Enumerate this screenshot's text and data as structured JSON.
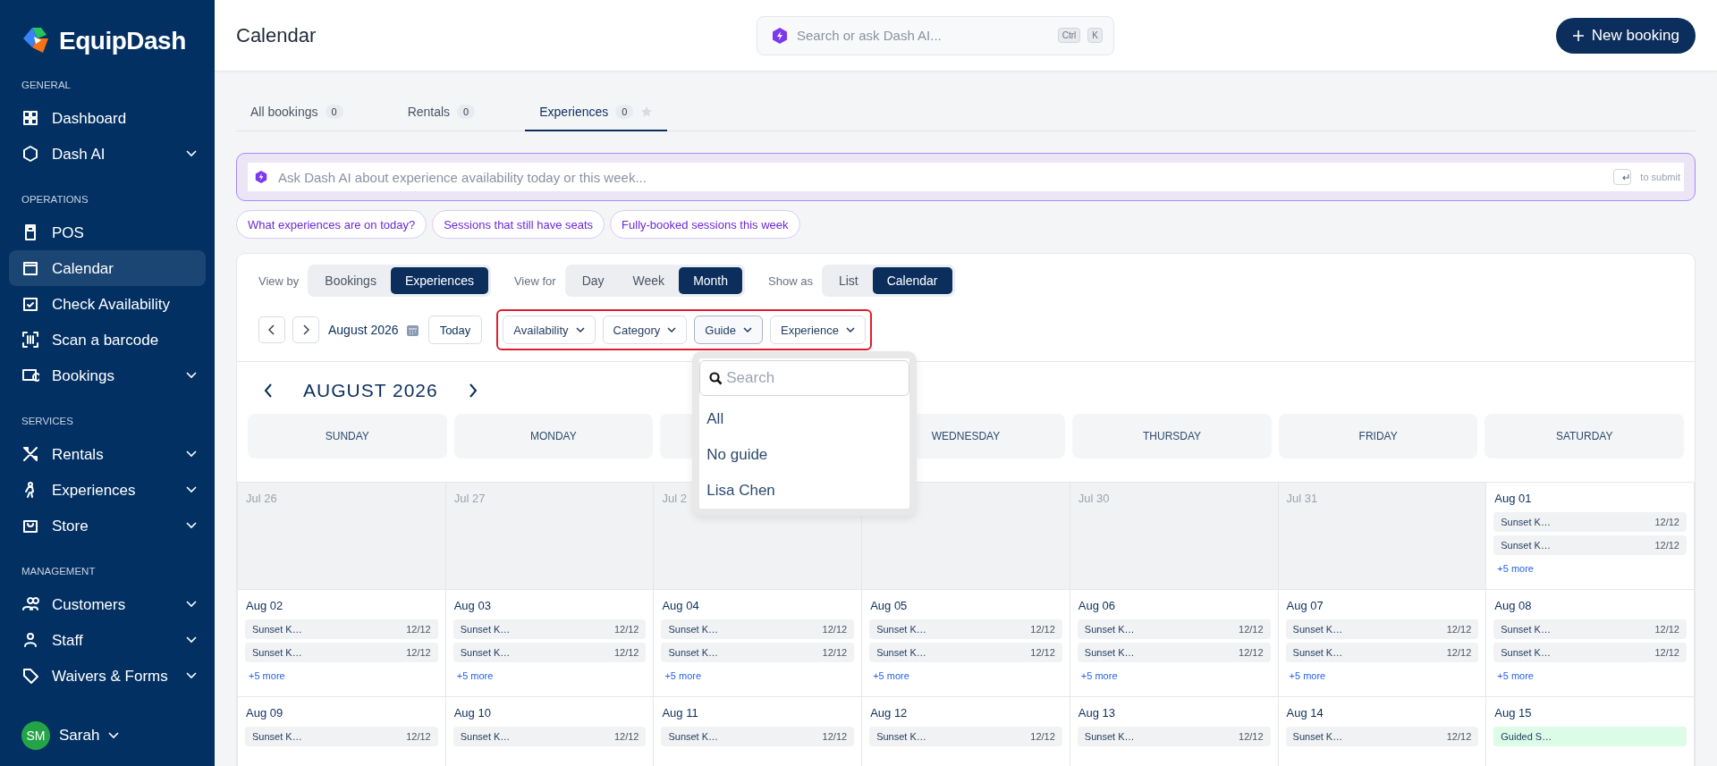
{
  "brand": {
    "name": "EquipDash"
  },
  "sidebar": {
    "sections": [
      {
        "label": "GENERAL",
        "items": [
          {
            "label": "Dashboard",
            "selected": false,
            "expandable": false
          },
          {
            "label": "Dash AI",
            "selected": false,
            "expandable": true
          }
        ]
      },
      {
        "label": "OPERATIONS",
        "items": [
          {
            "label": "POS",
            "selected": false,
            "expandable": false
          },
          {
            "label": "Calendar",
            "selected": true,
            "expandable": false
          },
          {
            "label": "Check Availability",
            "selected": false,
            "expandable": false
          },
          {
            "label": "Scan a barcode",
            "selected": false,
            "expandable": false
          },
          {
            "label": "Bookings",
            "selected": false,
            "expandable": true
          }
        ]
      },
      {
        "label": "SERVICES",
        "items": [
          {
            "label": "Rentals",
            "selected": false,
            "expandable": true
          },
          {
            "label": "Experiences",
            "selected": false,
            "expandable": true
          },
          {
            "label": "Store",
            "selected": false,
            "expandable": true
          }
        ]
      },
      {
        "label": "MANAGEMENT",
        "items": [
          {
            "label": "Customers",
            "selected": false,
            "expandable": true
          },
          {
            "label": "Staff",
            "selected": false,
            "expandable": true
          },
          {
            "label": "Waivers & Forms",
            "selected": false,
            "expandable": true
          }
        ]
      }
    ],
    "user": {
      "initials": "SM",
      "name": "Sarah"
    }
  },
  "header": {
    "title": "Calendar",
    "search": {
      "placeholder": "Search or ask Dash AI...",
      "keys": [
        "Ctrl",
        "K"
      ]
    },
    "new_button": "New booking"
  },
  "tabs": [
    {
      "label": "All bookings",
      "count": "0",
      "selected": false
    },
    {
      "label": "Rentals",
      "count": "0",
      "selected": false
    },
    {
      "label": "Experiences",
      "count": "0",
      "selected": true
    }
  ],
  "ai_prompt": {
    "placeholder": "Ask Dash AI about experience availability today or this week...",
    "hint": "to submit"
  },
  "suggestions": [
    "What experiences are on today?",
    "Sessions that still have seats",
    "Fully-booked sessions this week"
  ],
  "view_controls": [
    {
      "label": "View by",
      "options": [
        {
          "label": "Bookings",
          "selected": false
        },
        {
          "label": "Experiences",
          "selected": true
        }
      ]
    },
    {
      "label": "View for",
      "options": [
        {
          "label": "Day",
          "selected": false
        },
        {
          "label": "Week",
          "selected": false
        },
        {
          "label": "Month",
          "selected": true
        }
      ]
    },
    {
      "label": "Show as",
      "options": [
        {
          "label": "List",
          "selected": false
        },
        {
          "label": "Calendar",
          "selected": true
        }
      ]
    }
  ],
  "period_nav": {
    "period": "August 2026",
    "today": "Today"
  },
  "filters": {
    "highlighted": true,
    "items": [
      {
        "label": "Availability",
        "open": false
      },
      {
        "label": "Category",
        "open": false
      },
      {
        "label": "Guide",
        "open": true,
        "search_placeholder": "Search",
        "options": [
          "All",
          "No guide",
          "Lisa Chen"
        ]
      },
      {
        "label": "Experience",
        "open": false
      }
    ]
  },
  "calendar": {
    "title": "AUGUST 2026",
    "weekdays": [
      {
        "label": "SUNDAY"
      },
      {
        "label": "MONDAY"
      },
      {
        "covered": true
      },
      {
        "label": "WEDNESDAY"
      },
      {
        "label": "THURSDAY"
      },
      {
        "label": "FRIDAY"
      },
      {
        "label": "SATURDAY"
      }
    ],
    "weeks": [
      {
        "days": [
          {
            "date": "Jul 26",
            "in_month": false
          },
          {
            "date": "Jul 27",
            "in_month": false
          },
          {
            "date": "Jul 2",
            "in_month": false
          },
          {
            "in_month": false
          },
          {
            "date": "Jul 30",
            "in_month": false
          },
          {
            "date": "Jul 31",
            "in_month": false
          },
          {
            "date": "Aug 01",
            "in_month": true,
            "more": "+5 more",
            "events": [
              {
                "title": "Sunset K…",
                "count": "12/12",
                "color": "#f1f2f4"
              },
              {
                "title": "Sunset K…",
                "count": "12/12",
                "color": "#f1f2f4"
              }
            ]
          }
        ]
      },
      {
        "days": [
          {
            "date": "Aug 02",
            "in_month": true,
            "more": "+5 more",
            "events": [
              {
                "title": "Sunset K…",
                "count": "12/12",
                "color": "#f1f2f4"
              },
              {
                "title": "Sunset K…",
                "count": "12/12",
                "color": "#f1f2f4"
              }
            ]
          },
          {
            "date": "Aug 03",
            "in_month": true,
            "more": "+5 more",
            "events": [
              {
                "title": "Sunset K…",
                "count": "12/12",
                "color": "#f1f2f4"
              },
              {
                "title": "Sunset K…",
                "count": "12/12",
                "color": "#f1f2f4"
              }
            ]
          },
          {
            "date": "Aug 04",
            "in_month": true,
            "more": "+5 more",
            "events": [
              {
                "title": "Sunset K…",
                "count": "12/12",
                "color": "#f1f2f4"
              },
              {
                "title": "Sunset K…",
                "count": "12/12",
                "color": "#f1f2f4"
              }
            ]
          },
          {
            "date": "Aug 05",
            "in_month": true,
            "more": "+5 more",
            "events": [
              {
                "title": "Sunset K…",
                "count": "12/12",
                "color": "#f1f2f4"
              },
              {
                "title": "Sunset K…",
                "count": "12/12",
                "color": "#f1f2f4"
              }
            ]
          },
          {
            "date": "Aug 06",
            "in_month": true,
            "more": "+5 more",
            "events": [
              {
                "title": "Sunset K…",
                "count": "12/12",
                "color": "#f1f2f4"
              },
              {
                "title": "Sunset K…",
                "count": "12/12",
                "color": "#f1f2f4"
              }
            ]
          },
          {
            "date": "Aug 07",
            "in_month": true,
            "more": "+5 more",
            "events": [
              {
                "title": "Sunset K…",
                "count": "12/12",
                "color": "#f1f2f4"
              },
              {
                "title": "Sunset K…",
                "count": "12/12",
                "color": "#f1f2f4"
              }
            ]
          },
          {
            "date": "Aug 08",
            "in_month": true,
            "more": "+5 more",
            "events": [
              {
                "title": "Sunset K…",
                "count": "12/12",
                "color": "#f1f2f4"
              },
              {
                "title": "Sunset K…",
                "count": "12/12",
                "color": "#f1f2f4"
              }
            ]
          }
        ]
      },
      {
        "days": [
          {
            "date": "Aug 09",
            "in_month": true,
            "events": [
              {
                "title": "Sunset K…",
                "count": "12/12",
                "color": "#f1f2f4"
              }
            ]
          },
          {
            "date": "Aug 10",
            "in_month": true,
            "events": [
              {
                "title": "Sunset K…",
                "count": "12/12",
                "color": "#f1f2f4"
              }
            ]
          },
          {
            "date": "Aug 11",
            "in_month": true,
            "events": [
              {
                "title": "Sunset K…",
                "count": "12/12",
                "color": "#f1f2f4"
              }
            ]
          },
          {
            "date": "Aug 12",
            "in_month": true,
            "events": [
              {
                "title": "Sunset K…",
                "count": "12/12",
                "color": "#f1f2f4"
              }
            ]
          },
          {
            "date": "Aug 13",
            "in_month": true,
            "events": [
              {
                "title": "Sunset K…",
                "count": "12/12",
                "color": "#f1f2f4"
              }
            ]
          },
          {
            "date": "Aug 14",
            "in_month": true,
            "events": [
              {
                "title": "Sunset K…",
                "count": "12/12",
                "color": "#f1f2f4"
              }
            ]
          },
          {
            "date": "Aug 15",
            "in_month": true,
            "events": [
              {
                "title": "Guided S…",
                "color": "#dcfce7"
              }
            ]
          }
        ]
      }
    ]
  }
}
